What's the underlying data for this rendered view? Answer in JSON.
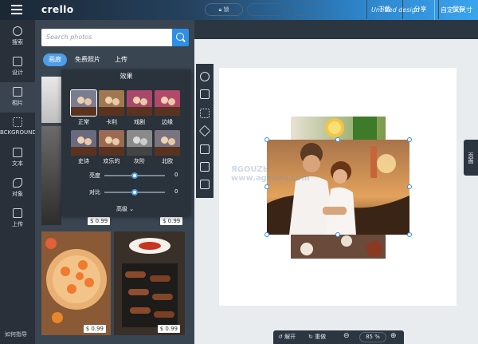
{
  "app": {
    "logo": "crello",
    "document_title": "Untitled design",
    "resize_button": "自定义尺寸"
  },
  "left_nav": {
    "items": [
      {
        "label": "搜索",
        "icon": "search-icon"
      },
      {
        "label": "设计",
        "icon": "layout-icon"
      },
      {
        "label": "相片",
        "icon": "photo-icon"
      },
      {
        "label": "BCKGROUND",
        "icon": "background-icon"
      },
      {
        "label": "文本",
        "icon": "text-icon"
      },
      {
        "label": "对象",
        "icon": "objects-icon"
      },
      {
        "label": "上传",
        "icon": "upload-icon"
      }
    ],
    "guide": "如何指导"
  },
  "panel": {
    "search_placeholder": "Search photos",
    "tabs": [
      "画廊",
      "免费照片",
      "上传"
    ],
    "prices": [
      "$ 0.99",
      "$ 0.99",
      "$ 0.99",
      "$ 0.99"
    ]
  },
  "effects": {
    "title": "效果",
    "filters": [
      "正常",
      "卡利",
      "戏剧",
      "边缘",
      "史诗",
      "欢乐的",
      "灰阶",
      "北欧"
    ],
    "brightness_label": "亮度",
    "brightness_value": "0",
    "brightness_level": 0.5,
    "contrast_label": "对比",
    "contrast_value": "0",
    "contrast_level": 0.5,
    "advanced": "高级"
  },
  "toolbar": {
    "lock": "锁",
    "download": "下载",
    "share": "分享",
    "save": "保存"
  },
  "bottom_bar": {
    "ungroup": "解开",
    "redo": "重做",
    "zoom": "85 %"
  },
  "right_tab": "页面",
  "watermark": "ЯGOUZЬ\nwww.agouzu.com",
  "colors": {
    "accent": "#2f8fe6",
    "topbar_dark": "#1b2733",
    "topbar_light": "#3aa4ef",
    "panel": "#3a4552",
    "nav": "#293039"
  }
}
